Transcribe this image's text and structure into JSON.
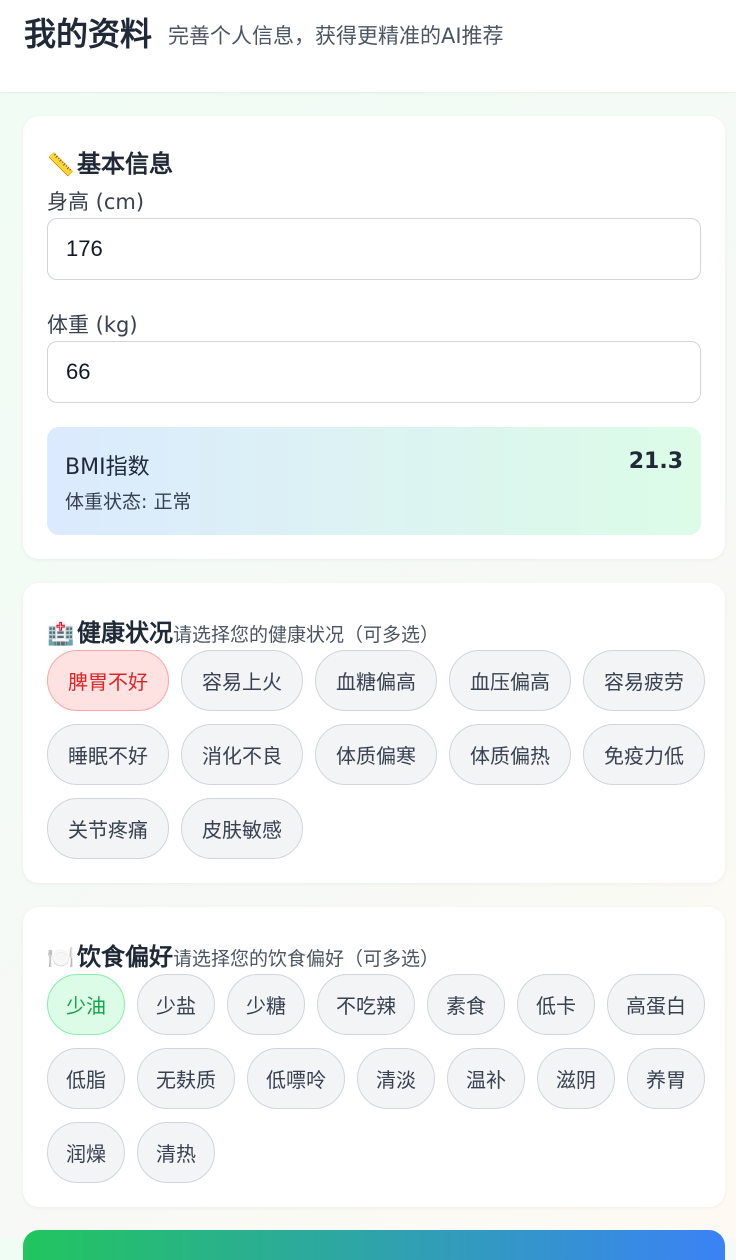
{
  "header": {
    "title": "我的资料",
    "subtitle": "完善个人信息，获得更精准的AI推荐"
  },
  "basic": {
    "icon": "ruler-icon",
    "icon_glyph": "📏",
    "title": "基本信息",
    "height_label": "身高 (cm)",
    "height_value": "176",
    "weight_label": "体重 (kg)",
    "weight_value": "66",
    "bmi_label": "BMI指数",
    "bmi_value": "21.3",
    "bmi_status": "体重状态: 正常"
  },
  "health": {
    "icon": "hospital-icon",
    "icon_glyph": "🏥",
    "title": "健康状况",
    "subtitle": "请选择您的健康状况（可多选）",
    "options": [
      {
        "label": "脾胃不好",
        "selected": true
      },
      {
        "label": "容易上火",
        "selected": false
      },
      {
        "label": "血糖偏高",
        "selected": false
      },
      {
        "label": "血压偏高",
        "selected": false
      },
      {
        "label": "容易疲劳",
        "selected": false
      },
      {
        "label": "睡眠不好",
        "selected": false
      },
      {
        "label": "消化不良",
        "selected": false
      },
      {
        "label": "体质偏寒",
        "selected": false
      },
      {
        "label": "体质偏热",
        "selected": false
      },
      {
        "label": "免疫力低",
        "selected": false
      },
      {
        "label": "关节疼痛",
        "selected": false
      },
      {
        "label": "皮肤敏感",
        "selected": false
      }
    ]
  },
  "diet": {
    "icon": "plate-cutlery-icon",
    "icon_glyph": "🍽️",
    "title": "饮食偏好",
    "subtitle": "请选择您的饮食偏好（可多选）",
    "options": [
      {
        "label": "少油",
        "selected": true
      },
      {
        "label": "少盐",
        "selected": false
      },
      {
        "label": "少糖",
        "selected": false
      },
      {
        "label": "不吃辣",
        "selected": false
      },
      {
        "label": "素食",
        "selected": false
      },
      {
        "label": "低卡",
        "selected": false
      },
      {
        "label": "高蛋白",
        "selected": false
      },
      {
        "label": "低脂",
        "selected": false
      },
      {
        "label": "无麸质",
        "selected": false
      },
      {
        "label": "低嘌呤",
        "selected": false
      },
      {
        "label": "清淡",
        "selected": false
      },
      {
        "label": "温补",
        "selected": false
      },
      {
        "label": "滋阴",
        "selected": false
      },
      {
        "label": "养胃",
        "selected": false
      },
      {
        "label": "润燥",
        "selected": false
      },
      {
        "label": "清热",
        "selected": false
      }
    ]
  },
  "colors": {
    "health_selected": "#dc2626",
    "diet_selected": "#16a34a",
    "accent_start": "#22c55e",
    "accent_end": "#3b82f6"
  }
}
